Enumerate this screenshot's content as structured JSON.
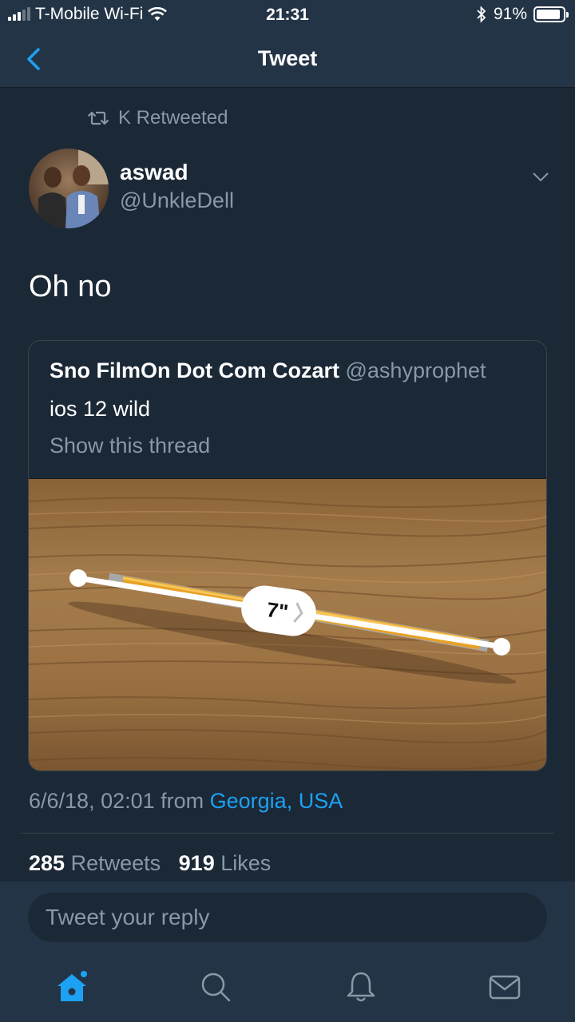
{
  "status_bar": {
    "carrier": "T-Mobile Wi-Fi",
    "time": "21:31",
    "battery": "91%",
    "battery_level": 0.91
  },
  "nav": {
    "title": "Tweet"
  },
  "retweet": {
    "label": "K Retweeted"
  },
  "author": {
    "name": "aswad",
    "handle": "@UnkleDell"
  },
  "tweet": {
    "text": "Oh no"
  },
  "quoted": {
    "name": "Sno FilmOn Dot Com Cozart",
    "handle": "@ashyprophet",
    "text": "ios 12 wild",
    "show_thread": "Show this thread",
    "measure_label": "7\""
  },
  "meta": {
    "date": "6/6/18, 02:01 from ",
    "location": "Georgia, USA"
  },
  "stats": {
    "retweets_count": "285",
    "retweets_label": "Retweets",
    "likes_count": "919",
    "likes_label": "Likes"
  },
  "reply": {
    "placeholder": "Tweet your reply"
  },
  "colors": {
    "accent": "#1da1f2",
    "background": "#1b2836",
    "bar": "#243447",
    "muted": "#8899a6"
  },
  "icons": [
    "chevron-left-icon",
    "retweet-icon",
    "chevron-down-icon",
    "home-icon",
    "search-icon",
    "bell-icon",
    "mail-icon"
  ]
}
